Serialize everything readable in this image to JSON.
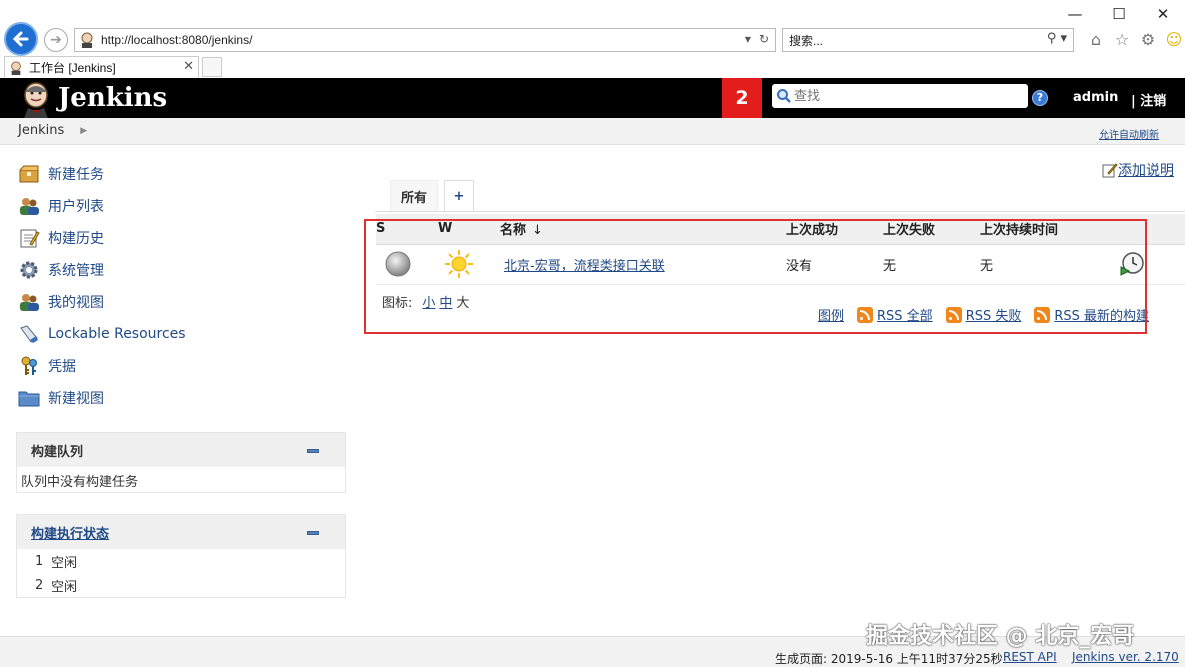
{
  "browser": {
    "url": "http://localhost:8080/jenkins/",
    "search_placeholder": "搜索...",
    "tab_title": "工作台 [Jenkins]",
    "minimize": "—",
    "maximize": "☐",
    "close": "✕"
  },
  "header": {
    "logo_text": "Jenkins",
    "notification_count": "2",
    "search_placeholder": "查找",
    "help": "?",
    "user": "admin",
    "logout": "| 注销"
  },
  "breadcrumb": {
    "root": "Jenkins",
    "auto_refresh": "允许自动刷新"
  },
  "sidebar": {
    "tasks": [
      {
        "label": "新建任务",
        "icon": "new-item-icon"
      },
      {
        "label": "用户列表",
        "icon": "users-icon"
      },
      {
        "label": "构建历史",
        "icon": "notepad-icon"
      },
      {
        "label": "系统管理",
        "icon": "gear-icon"
      },
      {
        "label": "我的视图",
        "icon": "users-icon"
      },
      {
        "label": "Lockable Resources",
        "icon": "usb-icon"
      },
      {
        "label": "凭据",
        "icon": "keys-icon"
      },
      {
        "label": "新建视图",
        "icon": "folder-icon"
      }
    ],
    "queue": {
      "title": "构建队列",
      "empty": "队列中没有构建任务"
    },
    "executors": {
      "title": "构建执行状态",
      "rows": [
        {
          "num": "1",
          "state": "空闲"
        },
        {
          "num": "2",
          "state": "空闲"
        }
      ]
    }
  },
  "main": {
    "add_description": "添加说明",
    "tabs": {
      "all": "所有",
      "add": "+"
    },
    "table": {
      "headers": {
        "s": "S",
        "w": "W",
        "name": "名称",
        "sort": "↓",
        "last_success": "上次成功",
        "last_failure": "上次失败",
        "last_duration": "上次持续时间"
      },
      "rows": [
        {
          "name": "北京-宏哥，流程类接口关联",
          "last_success": "没有",
          "last_failure": "无",
          "last_duration": "无",
          "status_icon": "grey-ball-icon",
          "weather_icon": "sunny-icon"
        }
      ]
    },
    "icon_size": {
      "label": "图标:",
      "small": "小",
      "medium": "中",
      "large": "大"
    },
    "feeds": {
      "legend": "图例",
      "all": "RSS 全部",
      "failed": "RSS 失败",
      "latest": "RSS 最新的构建"
    }
  },
  "footer": {
    "generated": "生成页面: 2019-5-16 上午11时37分25秒",
    "rest_api": "REST API",
    "version": "Jenkins ver. 2.170",
    "watermark": "掘金技术社区 @ 北京_宏哥"
  },
  "colors": {
    "link": "#204a87",
    "header_bg": "#000000",
    "badge": "#e31c1c",
    "highlight": "#e03030"
  }
}
